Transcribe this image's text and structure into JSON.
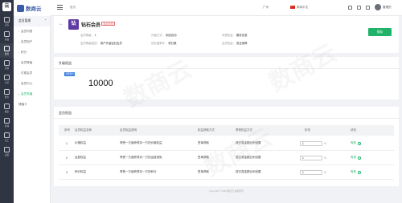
{
  "app": {
    "name": "数商云",
    "logo_letter": "云"
  },
  "rail": [
    {
      "label": "首页",
      "icon": "home-icon"
    },
    {
      "label": "商品",
      "icon": "goods-icon"
    },
    {
      "label": "会员",
      "icon": "member-icon",
      "active": true
    },
    {
      "label": "营销",
      "icon": "marketing-icon"
    },
    {
      "label": "订单",
      "icon": "order-icon"
    },
    {
      "label": "财务",
      "icon": "finance-icon"
    },
    {
      "label": "报表",
      "icon": "report-icon"
    },
    {
      "label": "商城",
      "icon": "mall-icon"
    },
    {
      "label": "员工",
      "icon": "staff-icon"
    },
    {
      "label": "设置",
      "icon": "settings-icon"
    }
  ],
  "sidebar": {
    "group": "会员管理",
    "items": [
      {
        "label": "会员列表"
      },
      {
        "label": "会员用户"
      },
      {
        "label": "积分",
        "active": false
      },
      {
        "label": "会员等级"
      },
      {
        "label": "付费会员"
      },
      {
        "label": "会员中心"
      },
      {
        "label": "会员充值",
        "active": true
      },
      {
        "label": "储值卡"
      }
    ]
  },
  "topbar": {
    "home": "首页",
    "location": "广州",
    "language": "简体中文",
    "user": "管理员"
  },
  "header": {
    "back": "←",
    "badge_letter": "钻",
    "title": "钻石会员",
    "tag": "用户会员",
    "meta": [
      {
        "k": "会员等级：",
        "v": "1"
      },
      {
        "k": "会员等级描述：",
        "v": "用户升级钻石会员"
      },
      {
        "k": "升级方式：",
        "v": "系统自动"
      },
      {
        "k": "成长值条件：",
        "v": "积分数"
      },
      {
        "k": "享受权益：",
        "v": "服务优惠"
      },
      {
        "k": "会员权益：",
        "v": "安全保障"
      }
    ],
    "save": "保存"
  },
  "upgrade": {
    "title": "升级权益",
    "condition_tag": "消费积分",
    "value": "10000"
  },
  "rights": {
    "title": "会员权益",
    "columns": [
      "序号",
      "会员权益名称",
      "会员权益说明",
      "权益获取方式",
      "享受权益方式",
      "折扣",
      "状态"
    ],
    "rows": [
      {
        "no": "1",
        "name": "价格权益",
        "desc": "享受一方面获得另一方的价格权益",
        "get": "签单获取",
        "use": "按交易金额比例设置",
        "discount": "1",
        "unit": "%",
        "status": "有效"
      },
      {
        "no": "2",
        "name": "运费权益",
        "desc": "享受一方面获得另一方的运费减免",
        "get": "签单获取",
        "use": "按交易金额比例设置",
        "discount": "1",
        "unit": "%",
        "status": "有效"
      },
      {
        "no": "3",
        "name": "积分权益",
        "desc": "享受一方面获得另一方的积分",
        "get": "签单获取",
        "use": "按交易金额比例设置",
        "discount": "1",
        "unit": "%",
        "status": "有效"
      }
    ]
  },
  "footer": "Copyright © 2020 数商云 版权所有",
  "watermark": "数商云",
  "colors": {
    "primary": "#20b268",
    "rail": "#2f3542",
    "badge": "#5e3aa3",
    "tag": "#e86b74",
    "cond": "#3b7de0"
  }
}
